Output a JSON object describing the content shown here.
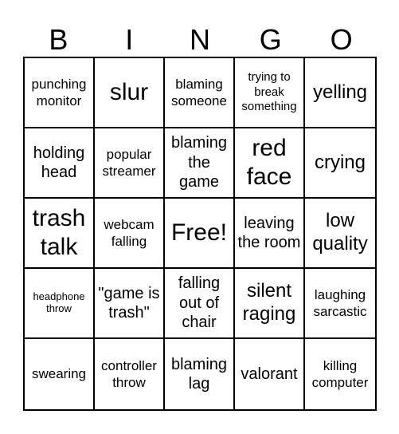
{
  "card": {
    "header_letters": [
      "B",
      "I",
      "N",
      "G",
      "O"
    ],
    "cells": [
      [
        {
          "text": "punching monitor",
          "size": "s-md"
        },
        {
          "text": "slur",
          "size": "s-xxl"
        },
        {
          "text": "blaming someone",
          "size": "s-md"
        },
        {
          "text": "trying to break something",
          "size": "s-sm"
        },
        {
          "text": "yelling",
          "size": "s-xl"
        }
      ],
      [
        {
          "text": "holding head",
          "size": "s-lg"
        },
        {
          "text": "popular streamer",
          "size": "s-md"
        },
        {
          "text": "blaming the game",
          "size": "s-lg"
        },
        {
          "text": "red face",
          "size": "s-xxl"
        },
        {
          "text": "crying",
          "size": "s-xl"
        }
      ],
      [
        {
          "text": "trash talk",
          "size": "s-xxl"
        },
        {
          "text": "webcam falling",
          "size": "s-md"
        },
        {
          "text": "Free!",
          "size": "s-xxl",
          "free": true
        },
        {
          "text": "leaving the room",
          "size": "s-lg"
        },
        {
          "text": "low quality",
          "size": "s-xl"
        }
      ],
      [
        {
          "text": "headphone throw",
          "size": "s-xs"
        },
        {
          "text": "\"game is trash\"",
          "size": "s-lg"
        },
        {
          "text": "falling out of chair",
          "size": "s-lg"
        },
        {
          "text": "silent raging",
          "size": "s-xl"
        },
        {
          "text": "laughing sarcastic",
          "size": "s-md"
        }
      ],
      [
        {
          "text": "swearing",
          "size": "s-md"
        },
        {
          "text": "controller throw",
          "size": "s-md"
        },
        {
          "text": "blaming lag",
          "size": "s-lg"
        },
        {
          "text": "valorant",
          "size": "s-lg"
        },
        {
          "text": "killing computer",
          "size": "s-md"
        }
      ]
    ]
  }
}
